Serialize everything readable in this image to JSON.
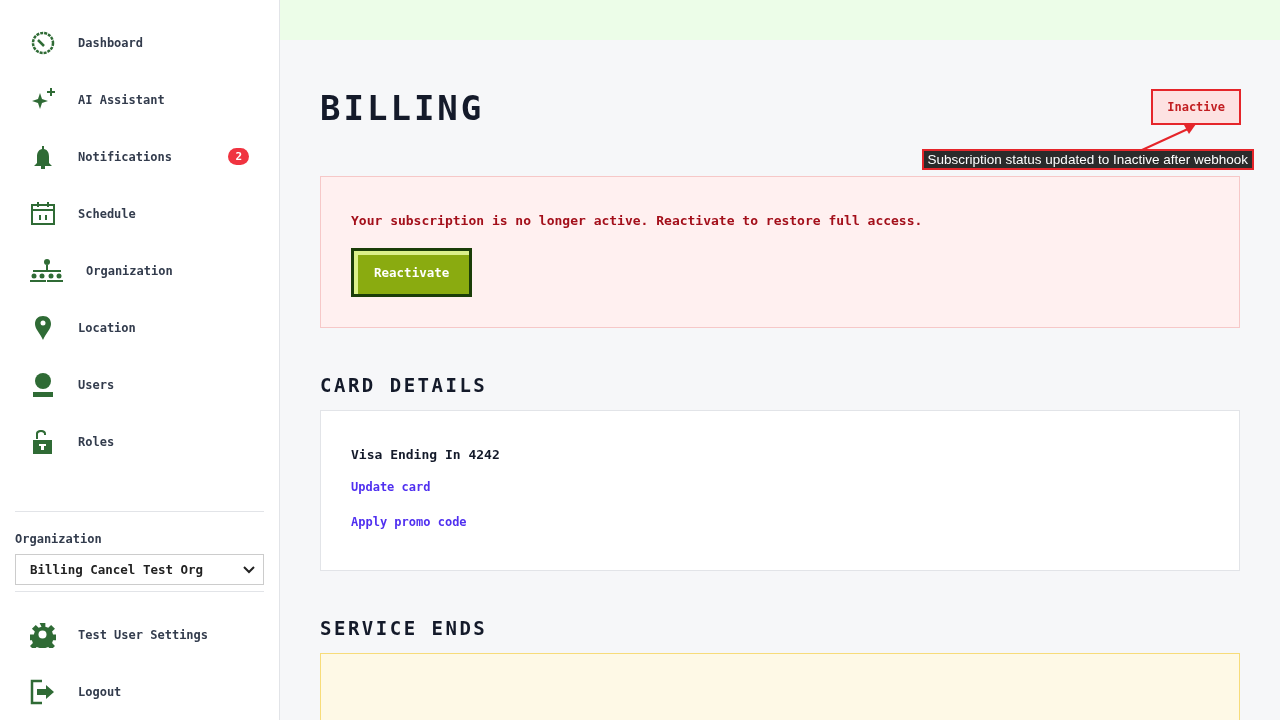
{
  "sidebar": {
    "items": [
      {
        "label": "Dashboard"
      },
      {
        "label": "AI Assistant"
      },
      {
        "label": "Notifications",
        "badge": "2"
      },
      {
        "label": "Schedule"
      },
      {
        "label": "Organization"
      },
      {
        "label": "Location"
      },
      {
        "label": "Users"
      },
      {
        "label": "Roles"
      }
    ],
    "org_label": "Organization",
    "org_value": "Billing Cancel Test Org",
    "footer": [
      {
        "label": "Test User Settings"
      },
      {
        "label": "Logout"
      }
    ]
  },
  "page": {
    "title": "BILLING",
    "status": "Inactive",
    "annotation": "Subscription status updated to Inactive after webhook"
  },
  "alert": {
    "message": "Your subscription is no longer active. Reactivate to restore full access.",
    "button": "Reactivate"
  },
  "card_details": {
    "heading": "CARD DETAILS",
    "card": "Visa Ending In 4242",
    "links": [
      "Update card",
      "Apply promo code"
    ]
  },
  "service_ends": {
    "heading": "SERVICE ENDS"
  }
}
